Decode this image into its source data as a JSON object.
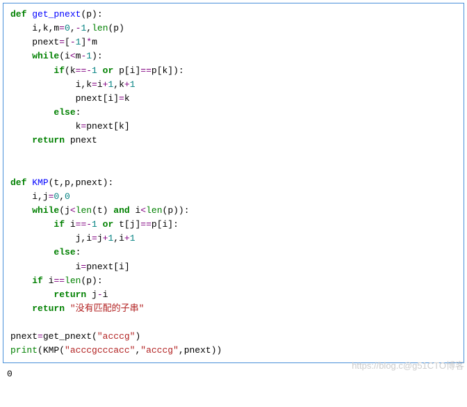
{
  "code": {
    "kw_def1": "def",
    "fn_get_pnext": "get_pnext",
    "args1": "(p):",
    "l2a": "    i,k,m",
    "l2op": "=",
    "l2n0": "0",
    "l2c1": ",",
    "l2nm1": "-",
    "l2n1": "1",
    "l2c2": ",",
    "l2len": "len",
    "l2end": "(p)",
    "l3a": "    pnext",
    "l3op": "=",
    "l3b": "[",
    "l3nm1": "-",
    "l3n1": "1",
    "l3c": "]",
    "l3op2": "*",
    "l3d": "m",
    "l4kw": "while",
    "l4a": "(i",
    "l4op": "<",
    "l4b": "m",
    "l4op2": "-",
    "l4n": "1",
    "l4c": "):",
    "l5kw": "if",
    "l5a": "(k",
    "l5op": "==-",
    "l5n": "1",
    "l5sp": " ",
    "l5or": "or",
    "l5b": " p[i]",
    "l5op2": "==",
    "l5c": "p[k]):",
    "l6a": "            i,k",
    "l6op": "=",
    "l6b": "i",
    "l6op2": "+",
    "l6n1": "1",
    "l6c": ",k",
    "l6op3": "+",
    "l6n2": "1",
    "l7a": "            pnext[i]",
    "l7op": "=",
    "l7b": "k",
    "l8kw": "else",
    "l8c": ":",
    "l9a": "            k",
    "l9op": "=",
    "l9b": "pnext[k]",
    "l10kw": "return",
    "l10a": " pnext",
    "kw_def2": "def",
    "fn_kmp": "KMP",
    "args2": "(t,p,pnext):",
    "k2a": "    i,j",
    "k2op": "=",
    "k2n0": "0",
    "k2c": ",",
    "k2n1": "0",
    "k3kw": "while",
    "k3a": "(j",
    "k3op": "<",
    "k3len1": "len",
    "k3b": "(t) ",
    "k3and": "and",
    "k3c": " i",
    "k3op2": "<",
    "k3len2": "len",
    "k3d": "(p)):",
    "k4kw": "if",
    "k4a": " i",
    "k4op": "==-",
    "k4n": "1",
    "k4sp": " ",
    "k4or": "or",
    "k4b": " t[j]",
    "k4op2": "==",
    "k4c": "p[i]:",
    "k5a": "            j,i",
    "k5op": "=",
    "k5b": "j",
    "k5op2": "+",
    "k5n1": "1",
    "k5c": ",i",
    "k5op3": "+",
    "k5n2": "1",
    "k6kw": "else",
    "k6c": ":",
    "k7a": "            i",
    "k7op": "=",
    "k7b": "pnext[i]",
    "k8kw": "if",
    "k8a": " i",
    "k8op": "==",
    "k8len": "len",
    "k8b": "(p):",
    "k9kw": "return",
    "k9a": " j",
    "k9op": "-",
    "k9b": "i",
    "k10kw": "return",
    "k10sp": " ",
    "k10str": "\"没有匹配的子串\"",
    "c1a": "pnext",
    "c1op": "=",
    "c1fn": "get_pnext",
    "c1p": "(",
    "c1str": "\"acccg\"",
    "c1e": ")",
    "c2pr": "print",
    "c2p": "(",
    "c2fn": "KMP",
    "c2p2": "(",
    "c2s1": "\"acccgcccacc\"",
    "c2c1": ",",
    "c2s2": "\"acccg\"",
    "c2c2": ",pnext))"
  },
  "output": "0",
  "watermark": "https://blog.c@g51CTO博客"
}
